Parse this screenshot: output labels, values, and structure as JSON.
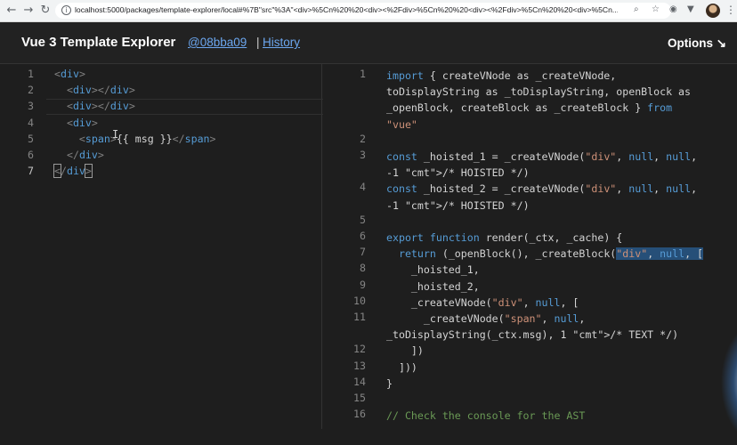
{
  "browser": {
    "nav": {
      "back": "←",
      "forward": "→",
      "reload": "↻"
    },
    "url": "localhost:5000/packages/template-explorer/local#%7B\"src\"%3A\"<div>%5Cn%20%20<div><%2Fdiv>%5Cn%20%20<div><%2Fdiv>%5Cn%20%20<div>%5Cn...",
    "icons": {
      "zoom": "⌕",
      "star": "☆",
      "ext1": "◉",
      "ext2": "▼",
      "menu": "⋮"
    }
  },
  "header": {
    "title": "Vue 3 Template Explorer",
    "commit": "@08bba09",
    "separator": "|",
    "history": "History",
    "options": "Options ↘"
  },
  "template_editor": {
    "line_numbers": [
      "1",
      "2",
      "3",
      "4",
      "5",
      "6",
      "7"
    ],
    "lines": [
      "<div>",
      "  <div></div>",
      "  <div></div>",
      "  <div>",
      "    <span>{{ msg }}</span>",
      "  </div>",
      "</div>"
    ]
  },
  "output_editor": {
    "lines": [
      {
        "num": "1",
        "text": "import { createVNode as _createVNode, toDisplayString as _toDisplayString, openBlock as _openBlock, createBlock as _createBlock } from \"vue\""
      },
      {
        "num": "2",
        "text": ""
      },
      {
        "num": "3",
        "text": "const _hoisted_1 = _createVNode(\"div\", null, null, -1 /* HOISTED */)"
      },
      {
        "num": "4",
        "text": "const _hoisted_2 = _createVNode(\"div\", null, null, -1 /* HOISTED */)"
      },
      {
        "num": "5",
        "text": ""
      },
      {
        "num": "6",
        "text": "export function render(_ctx, _cache) {"
      },
      {
        "num": "7",
        "text": "  return (_openBlock(), _createBlock(\"div\", null, ["
      },
      {
        "num": "8",
        "text": "    _hoisted_1,"
      },
      {
        "num": "9",
        "text": "    _hoisted_2,"
      },
      {
        "num": "10",
        "text": "    _createVNode(\"div\", null, ["
      },
      {
        "num": "11",
        "text": "      _createVNode(\"span\", null, _toDisplayString(_ctx.msg), 1 /* TEXT */)"
      },
      {
        "num": "12",
        "text": "    ])"
      },
      {
        "num": "13",
        "text": "  ]))"
      },
      {
        "num": "14",
        "text": "}"
      },
      {
        "num": "15",
        "text": ""
      },
      {
        "num": "16",
        "text": "// Check the console for the AST"
      }
    ]
  },
  "colors": {
    "background": "#1e1e1e",
    "link": "#6ca7f0",
    "keyword": "#569cd6",
    "string": "#ce9178",
    "comment": "#6a9955"
  }
}
